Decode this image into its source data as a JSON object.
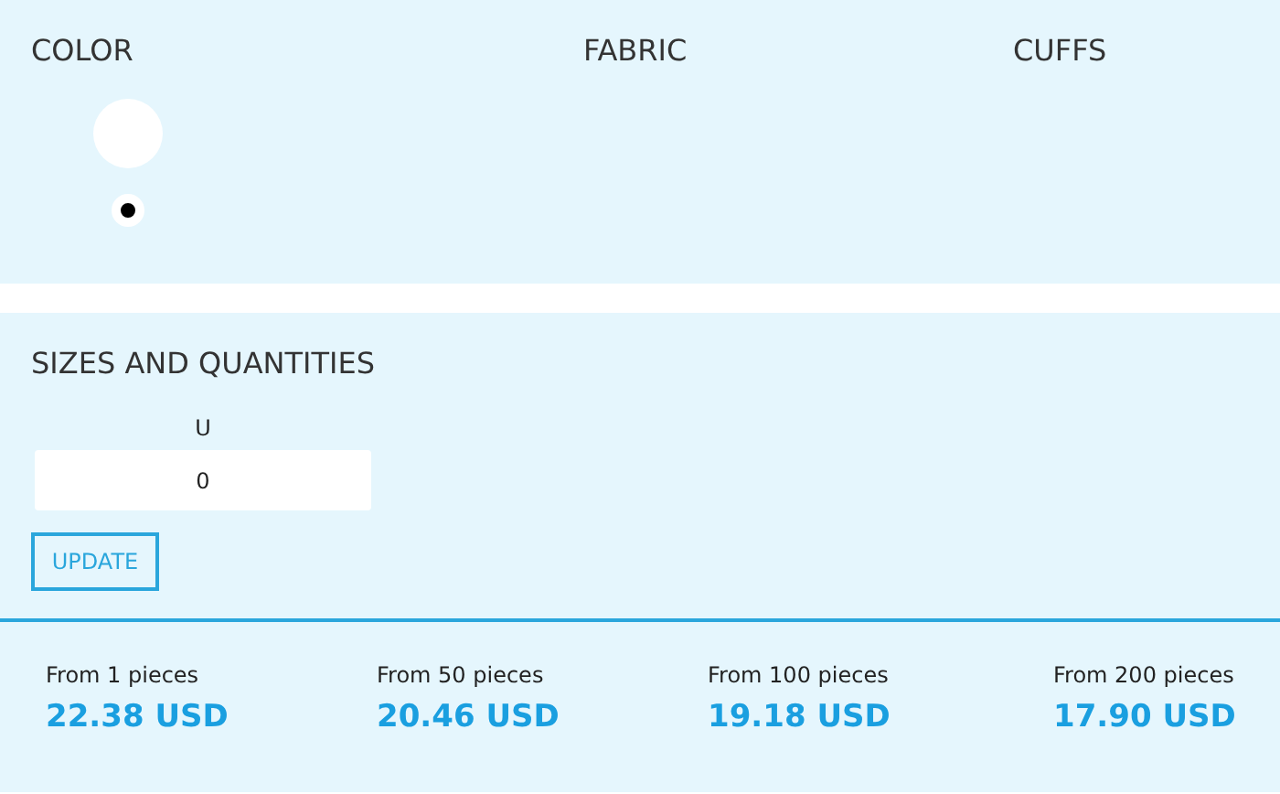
{
  "options": {
    "headings": [
      "COLOR",
      "FABRIC",
      "CUFFS"
    ],
    "colors": [
      {
        "color": "#ffffff",
        "selected": true
      }
    ]
  },
  "sizes": {
    "title": "SIZES AND QUANTITIES",
    "fields": [
      {
        "label": "U",
        "value": "0"
      }
    ],
    "button": "UPDATE"
  },
  "prices": [
    {
      "label": "From 1 pieces",
      "price": "22.38 USD"
    },
    {
      "label": "From 50 pieces",
      "price": "20.46 USD"
    },
    {
      "label": "From 100 pieces",
      "price": "19.18 USD"
    },
    {
      "label": "From 200 pieces",
      "price": "17.90 USD"
    }
  ]
}
